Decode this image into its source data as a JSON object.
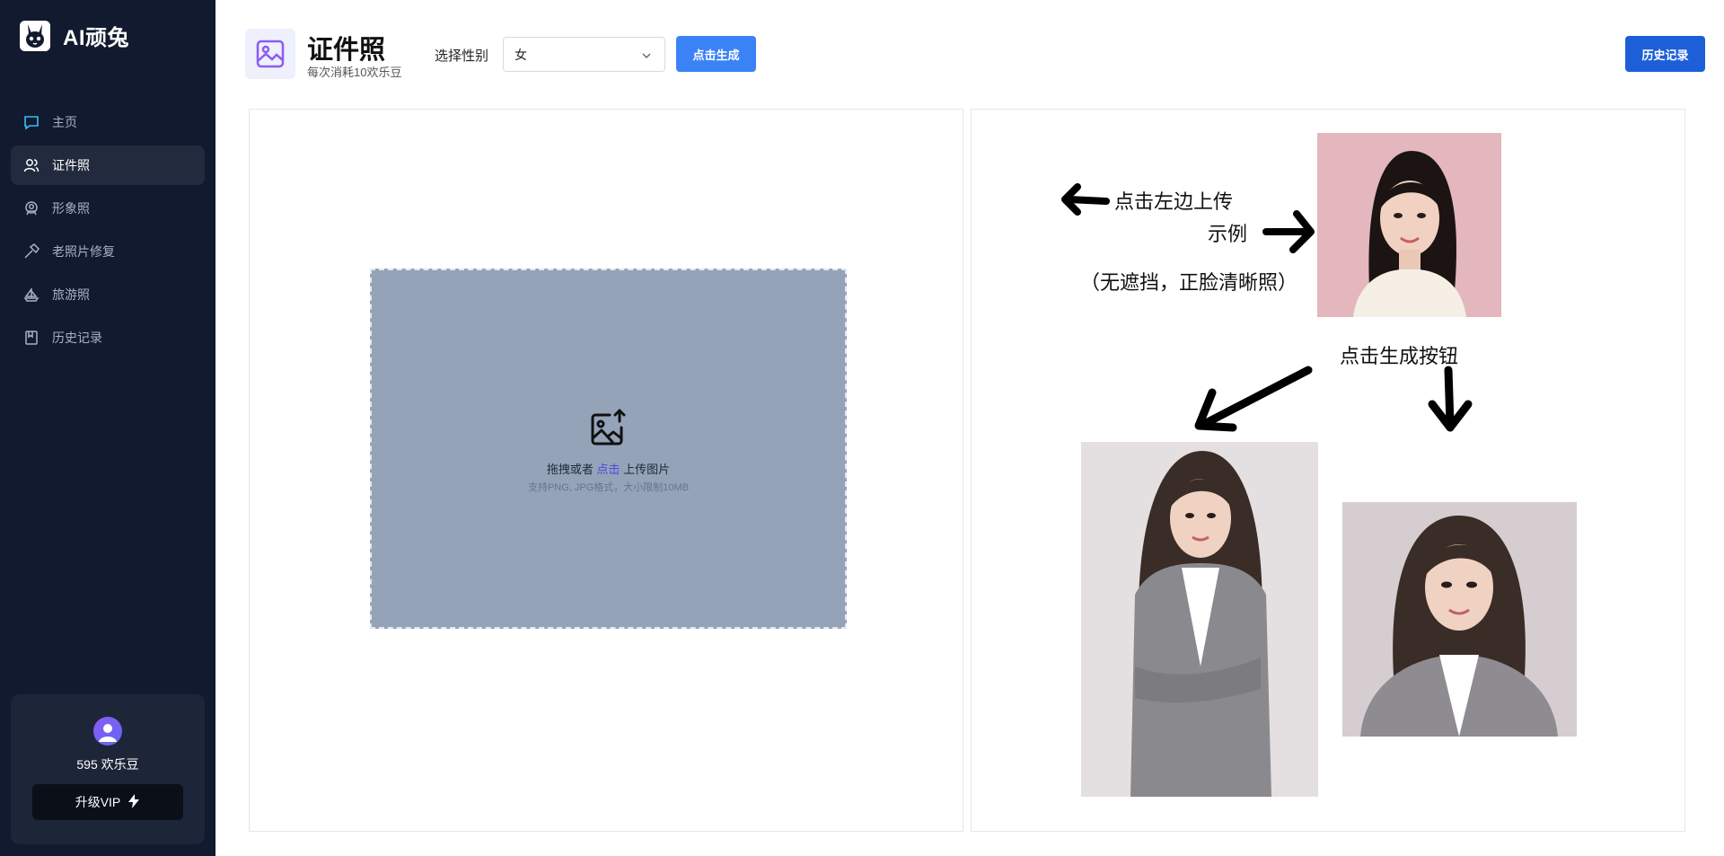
{
  "app": {
    "name": "AI顽兔"
  },
  "sidebar": {
    "items": [
      {
        "label": "主页",
        "icon": "chat-bubble-icon"
      },
      {
        "label": "证件照",
        "icon": "users-icon",
        "active": true
      },
      {
        "label": "形象照",
        "icon": "portrait-icon"
      },
      {
        "label": "老照片修复",
        "icon": "hammer-icon"
      },
      {
        "label": "旅游照",
        "icon": "sailboat-icon"
      },
      {
        "label": "历史记录",
        "icon": "bookmark-icon"
      }
    ],
    "account": {
      "coins": "595 欢乐豆",
      "vip_label": "升级VIP"
    }
  },
  "header": {
    "title": "证件照",
    "subtitle": "每次消耗10欢乐豆",
    "gender_label": "选择性别",
    "gender_value": "女",
    "generate_label": "点击生成",
    "history_label": "历史记录"
  },
  "upload": {
    "prefix": "拖拽或者",
    "link": "点击",
    "suffix": "上传图片",
    "hint": "支持PNG, JPG格式，大小限制10MB"
  },
  "example": {
    "line1": "点击左边上传",
    "line2": "示例",
    "line3": "（无遮挡，正脸清晰照）",
    "line4": "点击生成按钮"
  },
  "colors": {
    "sidebar_bg": "#111a2e",
    "primary": "#3b82f6",
    "history": "#1d5fd9",
    "dropzone": "#94a3b8",
    "link": "#4f46e5"
  }
}
